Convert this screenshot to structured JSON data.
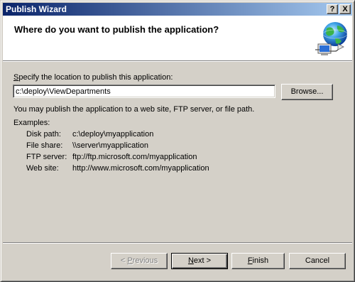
{
  "window": {
    "title": "Publish Wizard",
    "help_glyph": "?",
    "close_glyph": "X"
  },
  "header": {
    "title": "Where do you want to publish the application?",
    "icon": "globe-network-icon"
  },
  "location": {
    "label_mnemonic": "S",
    "label_rest": "pecify the location to publish this application:",
    "value": "c:\\deploy\\ViewDepartments",
    "browse_label": "Browse..."
  },
  "info_text": "You may publish the application to a web site, FTP server, or file path.",
  "examples": {
    "heading": "Examples:",
    "rows": [
      {
        "key": "Disk path:",
        "value": "c:\\deploy\\myapplication"
      },
      {
        "key": "File share:",
        "value": "\\\\server\\myapplication"
      },
      {
        "key": "FTP server:",
        "value": "ftp://ftp.microsoft.com/myapplication"
      },
      {
        "key": "Web site:",
        "value": "http://www.microsoft.com/myapplication"
      }
    ]
  },
  "buttons": {
    "previous": {
      "prefix": "< ",
      "mnemonic": "P",
      "rest": "revious",
      "enabled": false
    },
    "next": {
      "mnemonic": "N",
      "rest": "ext >"
    },
    "finish": {
      "mnemonic": "F",
      "rest": "inish"
    },
    "cancel": "Cancel"
  },
  "colors": {
    "titlebar_start": "#0a246a",
    "titlebar_end": "#a6caf0",
    "face": "#d4d0c8"
  }
}
